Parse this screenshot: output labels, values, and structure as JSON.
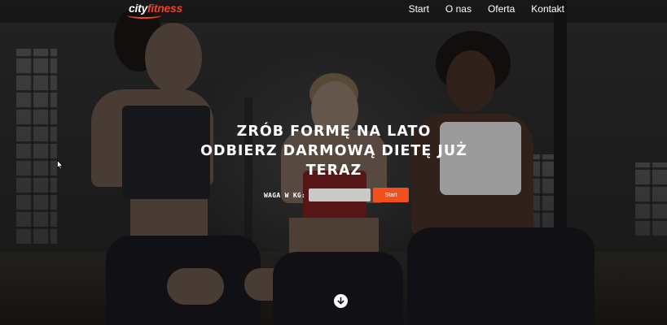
{
  "brand": {
    "logo_text_city": "city",
    "logo_text_fitness": "fitness",
    "accent": "#f0511f"
  },
  "nav": {
    "items": [
      {
        "label": "Start"
      },
      {
        "label": "O nas"
      },
      {
        "label": "Oferta"
      },
      {
        "label": "Kontakt"
      }
    ]
  },
  "hero": {
    "headline_line1": "ZRÓB FORMĘ NA LATO",
    "headline_line2": "ODBIERZ DARMOWĄ DIETĘ JUŻ",
    "headline_line3": "TERAZ",
    "weight_label": "WAGA W KG:",
    "weight_value": "",
    "submit_label": "Start",
    "scroll_icon": "arrow-down-circle-icon"
  }
}
